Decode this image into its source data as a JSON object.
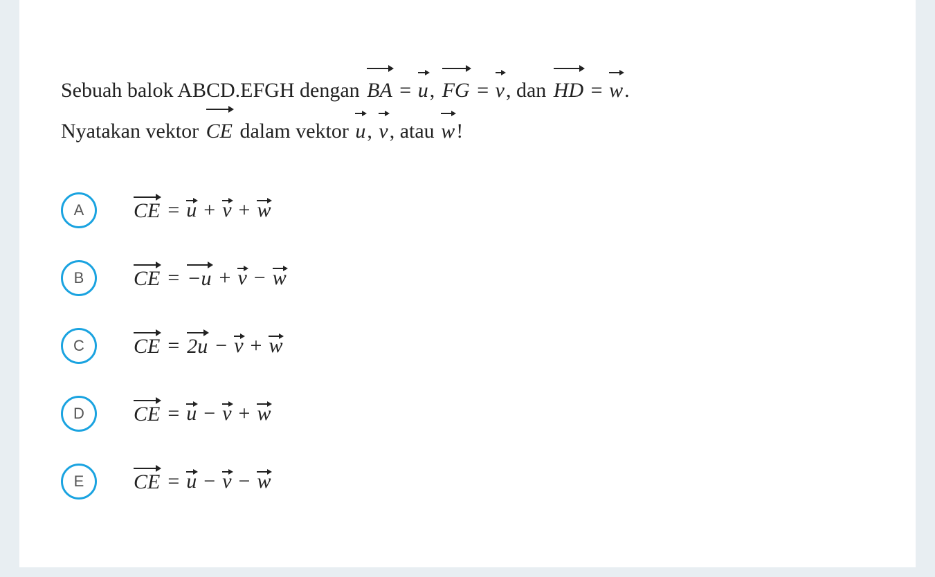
{
  "question": {
    "part1": "Sebuah balok ABCD.EFGH dengan ",
    "ba_vec": "BA",
    "eq1": " = ",
    "u": "u",
    "sep1": ", ",
    "fg_vec": "FG",
    "eq2": " = ",
    "v": "v",
    "sep2": ", dan ",
    "hd_vec": "HD",
    "eq3": " = ",
    "w": "w",
    "end1": ".",
    "part2a": "Nyatakan vektor ",
    "ce_vec": "CE",
    "part2b": " dalam vektor ",
    "u2": "u",
    "sep3": ", ",
    "v2": "v",
    "sep4": ", atau ",
    "w2": "w",
    "end2": "!"
  },
  "options": {
    "A": {
      "letter": "A",
      "ce": "CE",
      "eq": " = ",
      "t1": "u",
      "op1": " + ",
      "t2": "v",
      "op2": " + ",
      "t3": "w"
    },
    "B": {
      "letter": "B",
      "ce": "CE",
      "eq": " = ",
      "t1": "−u",
      "op1": " + ",
      "t2": "v",
      "op2": " − ",
      "t3": "w"
    },
    "C": {
      "letter": "C",
      "ce": "CE",
      "eq": " = ",
      "t1": "2u",
      "op1": " − ",
      "t2": "v",
      "op2": " + ",
      "t3": "w"
    },
    "D": {
      "letter": "D",
      "ce": "CE",
      "eq": " = ",
      "t1": "u",
      "op1": " − ",
      "t2": "v",
      "op2": " + ",
      "t3": "w"
    },
    "E": {
      "letter": "E",
      "ce": "CE",
      "eq": " = ",
      "t1": "u",
      "op1": " − ",
      "t2": "v",
      "op2": " − ",
      "t3": "w"
    }
  },
  "colors": {
    "accent": "#1aa3e0"
  }
}
